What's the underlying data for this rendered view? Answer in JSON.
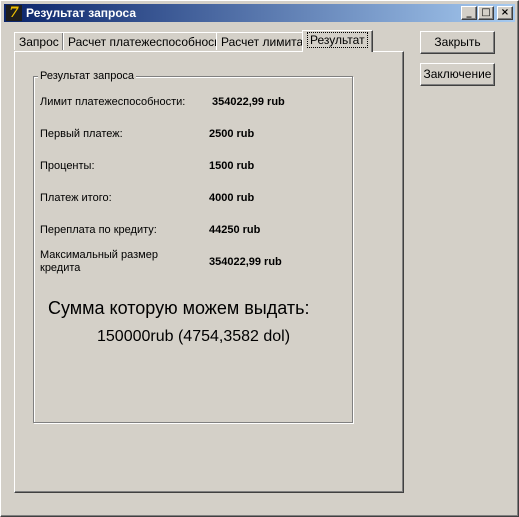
{
  "window": {
    "title": "Результат запроса",
    "icon": "delphi-app-icon",
    "controls": {
      "minimize": "_",
      "maximize": "□",
      "close": "×"
    }
  },
  "tabs": [
    {
      "label": "Запрос",
      "active": false
    },
    {
      "label": "Расчет платежеспособноси",
      "active": false
    },
    {
      "label": "Расчет лимита",
      "active": false
    },
    {
      "label": "Результат",
      "active": true
    }
  ],
  "group": {
    "title": "Результат запроса",
    "rows": [
      {
        "label": "Лимит платежеспособности:",
        "value": "354022,99 rub"
      },
      {
        "label": "Первый  платеж:",
        "value": "2500 rub"
      },
      {
        "label": "Проценты:",
        "value": "1500 rub"
      },
      {
        "label": "Платеж итого:",
        "value": "4000 rub"
      },
      {
        "label": "Переплата по кредиту:",
        "value": "44250 rub"
      },
      {
        "label": "Максимальный размер",
        "label2": "кредита",
        "value": "354022,99 rub"
      }
    ],
    "summary_title": "Сумма которую можем выдать:",
    "summary_value": "150000rub (4754,3582 dol)"
  },
  "buttons": {
    "close_label": "Закрыть",
    "conclusion_label": "Заключение"
  }
}
